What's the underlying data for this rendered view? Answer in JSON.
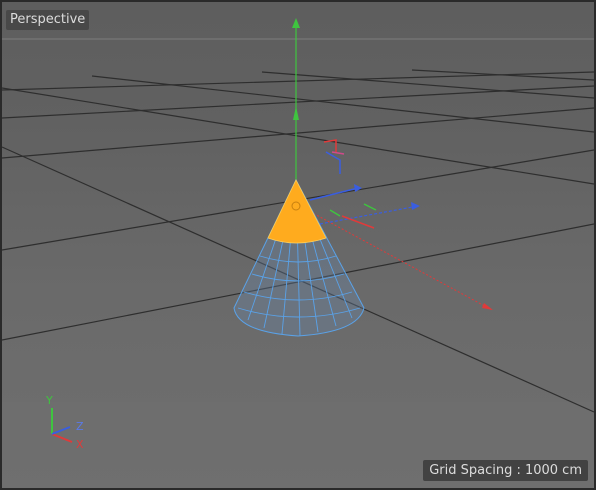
{
  "viewport": {
    "title": "Perspective",
    "grid_spacing_label": "Grid Spacing : 1000 cm"
  },
  "axes": {
    "x": "X",
    "y": "Y",
    "z": "Z"
  },
  "colors": {
    "x_axis": "#e03a3a",
    "y_axis": "#3fc43f",
    "z_axis": "#3a5ee0",
    "selected_tip": "#ffab1e",
    "wireframe": "#5aa2e8",
    "grid_line": "#2d2d2d",
    "background": "#646464"
  },
  "icons": {
    "gizmo": "move-gizmo-icon",
    "orientation": "axis-orientation-icon",
    "object": "cone-object"
  }
}
